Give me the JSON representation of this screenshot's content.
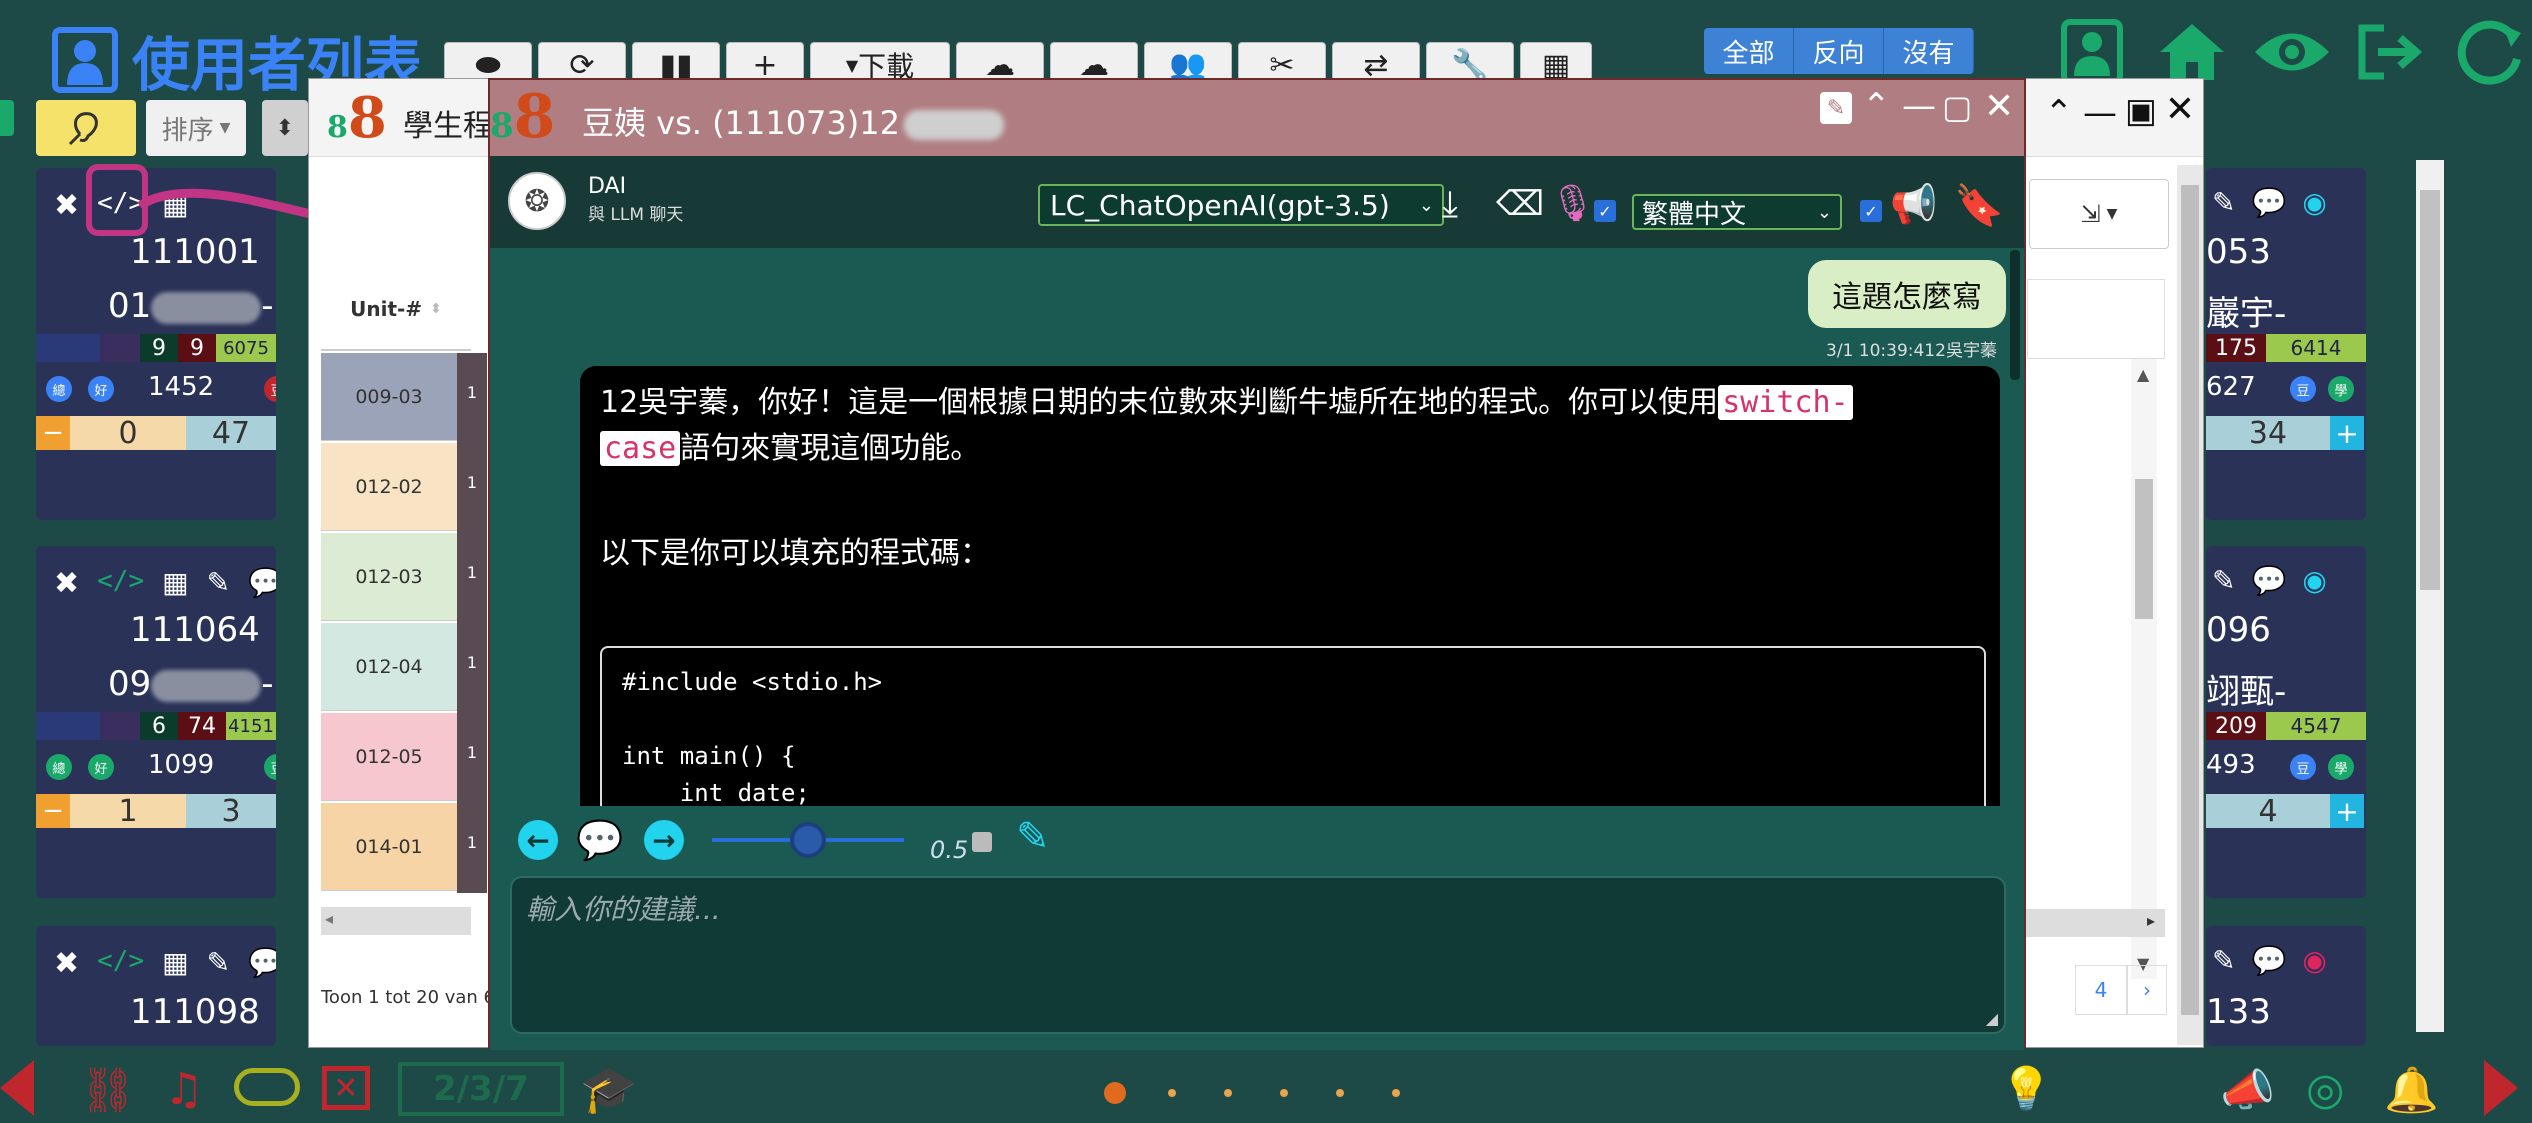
{
  "app": {
    "title": "使用者列表",
    "sort_label": "排序",
    "filter_buttons": [
      "全部",
      "反向",
      "沒有"
    ],
    "download_label": "下載"
  },
  "cards_left": [
    {
      "id": "111001",
      "name": "01",
      "name_suffix": "-",
      "stats": [
        "9",
        "9",
        "6075"
      ],
      "score": "1452",
      "counter_left": "0",
      "counter_right": "47",
      "pill_labels": [
        "總",
        "好",
        "豆"
      ]
    },
    {
      "id": "111064",
      "name": "09",
      "name_suffix": "-",
      "stats": [
        "6",
        "74",
        "4151"
      ],
      "score": "1099",
      "counter_left": "1",
      "counter_right": "3",
      "pill_labels": [
        "總",
        "好",
        "豆"
      ]
    },
    {
      "id": "111098"
    }
  ],
  "cards_right": [
    {
      "id": "053",
      "name": "巖宇-",
      "stats": [
        "175",
        "6414"
      ],
      "score": "627",
      "counter": "34",
      "pill_labels": [
        "豆",
        "學"
      ]
    },
    {
      "id": "096",
      "name": "翊甄-",
      "stats": [
        "209",
        "4547"
      ],
      "score": "493",
      "counter": "4",
      "pill_labels": [
        "豆",
        "學"
      ]
    },
    {
      "id": "133"
    }
  ],
  "table_window": {
    "title": "學生程",
    "column_header": "Unit-#",
    "rows": [
      {
        "unit": "009-03",
        "color": "#9aa3b8"
      },
      {
        "unit": "012-02",
        "color": "#f8e4c4"
      },
      {
        "unit": "012-03",
        "color": "#dcebd3"
      },
      {
        "unit": "012-04",
        "color": "#d4e8e2"
      },
      {
        "unit": "012-05",
        "color": "#f6c7cf"
      },
      {
        "unit": "014-01",
        "color": "#f7d4a6"
      }
    ],
    "row_index_glyph": "1",
    "footer_text": "Toon 1 tot 20 van 6",
    "page_number": "4",
    "page_next": "›"
  },
  "chat": {
    "title": "豆姨 vs. (111073)12",
    "bot_name": "DAI",
    "bot_subtitle": "與 LLM 聊天",
    "model_select": "LC_ChatOpenAI(gpt-3.5)",
    "language_select": "繁體中文",
    "user_message": "這題怎麼寫",
    "user_meta": "3/1 10:39:41",
    "user_name": "2吳宇蓁",
    "reply_intro": "12吳宇蓁，你好！這是一個根據日期的末位數來判斷牛墟所在地的程式。你可以使用",
    "reply_kw": "switch-case",
    "reply_kw_a": "switch-",
    "reply_kw_b": "case",
    "reply_after": "語句來實現這個功能。",
    "reply_second": "以下是你可以填充的程式碼：",
    "code_lines": [
      "#include <stdio.h>",
      "",
      "int main() {",
      "    int date;"
    ],
    "slider_value": "0.5",
    "input_placeholder": "輸入你的建議..."
  },
  "footer": {
    "page_indicator": "2/3/7"
  },
  "colors": {
    "accent": "#3b82f6",
    "title_bar": "#b07d82",
    "chat_bg": "#1b5a52",
    "pink": "#c13584",
    "cyan": "#22d3ee",
    "green": "#1aa86b"
  }
}
